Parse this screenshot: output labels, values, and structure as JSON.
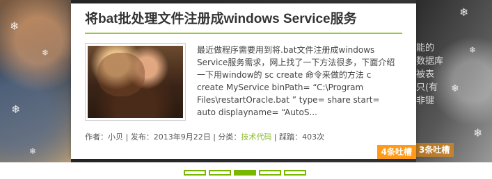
{
  "post": {
    "title": "将bat批处理文件注册成windows Service服务",
    "excerpt": "最近做程序需要用到将.bat文件注册成windows Service服务需求，网上找了一下方法很多，下面介绍一下用window的 sc create 命令来做的方法 c create MyService binPath= “C:\\Program Files\\restartOracle.bat ” type= share start= auto displayname= “AutoS...",
    "meta": {
      "author_prefix": "作者：",
      "author": "小贝",
      "date_prefix": " | 发布：",
      "date": "2013年9月22日",
      "category_prefix": " | 分类：",
      "category": "技术代码",
      "views_prefix": " | 踩踏：",
      "views": "403次"
    },
    "comments_badge": "4条吐槽"
  },
  "next_post_peek": {
    "text": "能的\n数据库\n被表\n只(有\n非键",
    "comments_badge": "3条吐槽"
  },
  "pager": {
    "count": 5,
    "active_index": 2
  },
  "colors": {
    "accent_green": "#7ab800",
    "badge_orange": "#ff9a1a",
    "link_green": "#8abb2a"
  }
}
